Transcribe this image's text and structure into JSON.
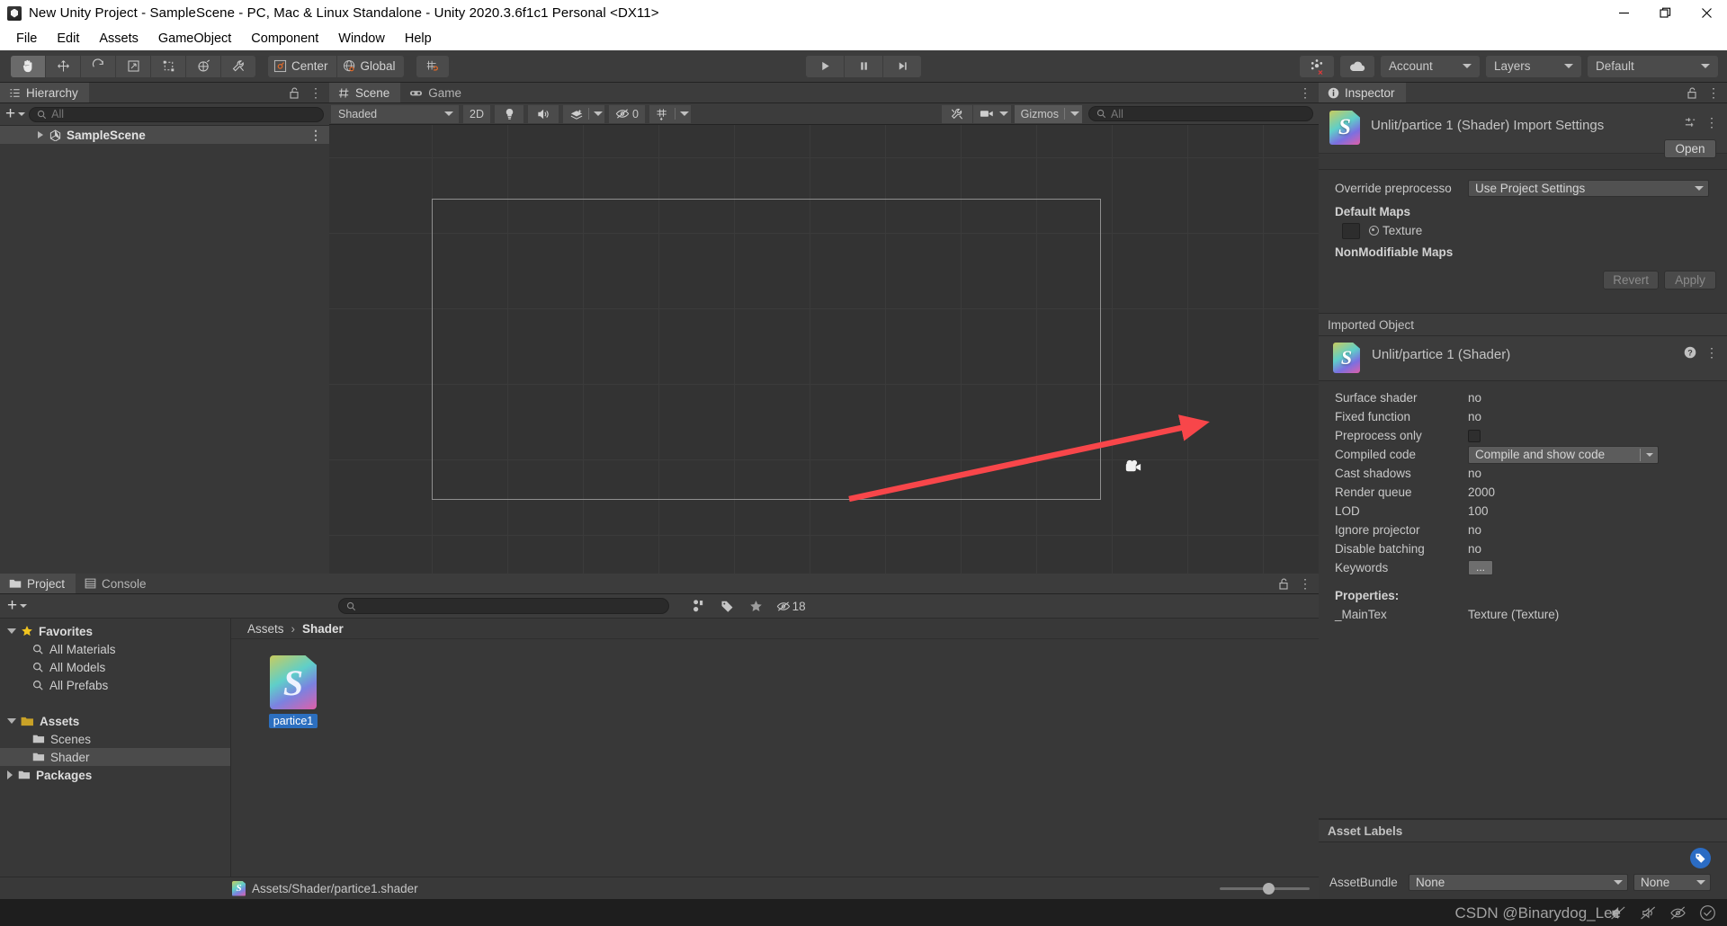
{
  "window": {
    "title": "New Unity Project - SampleScene - PC, Mac & Linux Standalone - Unity 2020.3.6f1c1 Personal <DX11>",
    "app_icon": "unity-logo-icon",
    "controls": {
      "minimize": "minimize-icon",
      "maximize": "maximize-icon",
      "close": "close-icon"
    }
  },
  "menubar": {
    "items": [
      "File",
      "Edit",
      "Assets",
      "GameObject",
      "Component",
      "Window",
      "Help"
    ]
  },
  "toolbar": {
    "tools": [
      {
        "name": "hand-tool",
        "icon": "hand-icon",
        "active": true
      },
      {
        "name": "move-tool",
        "icon": "move-icon",
        "active": false
      },
      {
        "name": "rotate-tool",
        "icon": "rotate-icon",
        "active": false
      },
      {
        "name": "scale-tool",
        "icon": "scale-icon",
        "active": false
      },
      {
        "name": "rect-tool",
        "icon": "rect-transform-icon",
        "active": false
      },
      {
        "name": "transform-tool",
        "icon": "transform-icon",
        "active": false
      },
      {
        "name": "custom-tool",
        "icon": "wrench-icon",
        "active": false
      }
    ],
    "pivot_label": "Center",
    "space_label": "Global",
    "snap_icon": "grid-snap-icon",
    "play": "play-icon",
    "pause": "pause-icon",
    "step": "step-icon",
    "collab_icon": "collab-icon",
    "cloud_icon": "cloud-icon",
    "account_label": "Account",
    "layers_label": "Layers",
    "layout_label": "Default"
  },
  "hierarchy": {
    "tab_label": "Hierarchy",
    "tab_icon": "hierarchy-icon",
    "lock_icon": "lock-open-icon",
    "menu_icon": "kebab-menu-icon",
    "create_label": "+",
    "search_placeholder": "All",
    "search_value": "",
    "items": [
      {
        "label": "SampleScene",
        "icon": "unity-scene-icon",
        "expanded": false,
        "selected": true
      }
    ]
  },
  "scene": {
    "tabs": [
      {
        "label": "Scene",
        "icon": "scene-grid-icon",
        "active": true
      },
      {
        "label": "Game",
        "icon": "gamepad-icon",
        "active": false
      }
    ],
    "menu_icon": "kebab-menu-icon",
    "draw_mode": "Shaded",
    "mode_2d": "2D",
    "lighting_icon": "light-bulb-icon",
    "audio_icon": "speaker-icon",
    "fx_icon": "effects-icon",
    "hidden_objects_count": "0",
    "grid_icon": "grid-visibility-icon",
    "tools_icon": "scene-tools-icon",
    "camera_icon": "scene-camera-icon",
    "gizmos_label": "Gizmos",
    "search_placeholder": "All",
    "search_value": "",
    "camera_gizmo": "camera-gizmo-icon",
    "annotation": "red-arrow-annotation"
  },
  "inspector": {
    "tab_label": "Inspector",
    "tab_icon": "info-icon",
    "lock_icon": "lock-open-icon",
    "menu_icon": "kebab-menu-icon",
    "header_title": "Unlit/partice 1 (Shader) Import Settings",
    "header_icon": "shader-asset-icon",
    "preset_icon": "preset-icon",
    "open_label": "Open",
    "override_label": "Override preprocesso",
    "override_value": "Use Project Settings",
    "default_maps_label": "Default Maps",
    "texture_label": "Texture",
    "nonmodifiable_label": "NonModifiable Maps",
    "revert_label": "Revert",
    "apply_label": "Apply",
    "imported_object_label": "Imported Object",
    "imported_title": "Unlit/partice 1 (Shader)",
    "help_icon": "help-circle-icon",
    "properties": [
      {
        "label": "Surface shader",
        "value": "no",
        "type": "text"
      },
      {
        "label": "Fixed function",
        "value": "no",
        "type": "text"
      },
      {
        "label": "Preprocess only",
        "value": "",
        "type": "checkbox"
      },
      {
        "label": "Compiled code",
        "value": "Compile and show code",
        "type": "dropdown"
      },
      {
        "label": "Cast shadows",
        "value": "no",
        "type": "text"
      },
      {
        "label": "Render queue",
        "value": "2000",
        "type": "text"
      },
      {
        "label": "LOD",
        "value": "100",
        "type": "text"
      },
      {
        "label": "Ignore projector",
        "value": "no",
        "type": "text"
      },
      {
        "label": "Disable batching",
        "value": "no",
        "type": "text"
      },
      {
        "label": "Keywords",
        "value": "...",
        "type": "button"
      }
    ],
    "properties_header": "Properties:",
    "shader_properties": [
      {
        "label": "_MainTex",
        "value": "Texture (Texture)"
      }
    ],
    "asset_labels_header": "Asset Labels",
    "label_tag_icon": "label-tag-icon",
    "assetbundle_label": "AssetBundle",
    "assetbundle_value": "None",
    "assetbundle_variant": "None"
  },
  "project": {
    "tabs": [
      {
        "label": "Project",
        "icon": "folder-icon",
        "active": true
      },
      {
        "label": "Console",
        "icon": "console-icon",
        "active": false
      }
    ],
    "lock_icon": "lock-open-icon",
    "menu_icon": "kebab-menu-icon",
    "create_label": "+",
    "search_placeholder": "",
    "search_value": "",
    "filter_icons": [
      "asset-type-filter-icon",
      "label-filter-icon",
      "favorite-star-icon"
    ],
    "hidden_count": "18",
    "tree": [
      {
        "label": "Favorites",
        "icon": "star-icon",
        "depth": 0,
        "twisty": "expanded",
        "bold": true,
        "selected": false
      },
      {
        "label": "All Materials",
        "icon": "search-icon",
        "depth": 1,
        "twisty": "none",
        "bold": false,
        "selected": false
      },
      {
        "label": "All Models",
        "icon": "search-icon",
        "depth": 1,
        "twisty": "none",
        "bold": false,
        "selected": false
      },
      {
        "label": "All Prefabs",
        "icon": "search-icon",
        "depth": 1,
        "twisty": "none",
        "bold": false,
        "selected": false
      },
      {
        "label": "",
        "icon": "",
        "depth": 0,
        "twisty": "none",
        "bold": false,
        "selected": false
      },
      {
        "label": "Assets",
        "icon": "folder-open-icon",
        "depth": 0,
        "twisty": "expanded",
        "bold": true,
        "selected": false
      },
      {
        "label": "Scenes",
        "icon": "folder-icon",
        "depth": 1,
        "twisty": "none",
        "bold": false,
        "selected": false
      },
      {
        "label": "Shader",
        "icon": "folder-icon",
        "depth": 1,
        "twisty": "none",
        "bold": false,
        "selected": true
      },
      {
        "label": "Packages",
        "icon": "folder-icon",
        "depth": 0,
        "twisty": "collapsed",
        "bold": true,
        "selected": false
      }
    ],
    "breadcrumb": [
      "Assets",
      "Shader"
    ],
    "assets": [
      {
        "name": "partice1",
        "icon": "shader-asset-icon",
        "selected": true
      }
    ],
    "status_path": "Assets/Shader/partice1.shader",
    "status_icon": "shader-asset-icon",
    "zoom_value": 48
  },
  "footer": {
    "watermark": "CSDN @Binarydog_Lee",
    "icons": [
      "mute-icon",
      "no-audio-icon",
      "hidden-eye-icon",
      "check-circle-icon"
    ]
  },
  "colors": {
    "panel_bg": "#383838",
    "panel_header": "#3c3c3c",
    "selection_blue": "#2c6fbf",
    "row_selected": "#4b4b4b",
    "text": "#c8c8c8",
    "annotation_red": "#f8464a",
    "titlebar_bg": "#ffffff"
  }
}
